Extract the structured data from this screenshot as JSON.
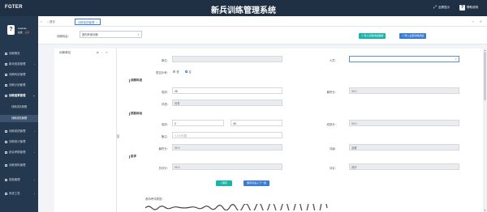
{
  "app": {
    "brand": "FGTER",
    "title": "新兵训练管理系统"
  },
  "top_actions": {
    "fullscreen_label": "全屏显示",
    "help_label": "帮助说明"
  },
  "user": {
    "avatar_text": "?",
    "name": "Auwbule",
    "status": "在线",
    "logout": "注销"
  },
  "sidebar": {
    "items": [
      {
        "label": "训练概览",
        "icon": "home-icon"
      },
      {
        "label": "新兵信息管理",
        "icon": "users-icon",
        "has_children": true
      },
      {
        "label": "训练科目管理",
        "icon": "list-icon"
      },
      {
        "label": "训练计划管理",
        "icon": "calendar-icon"
      },
      {
        "label": "训练结果管理",
        "icon": "edit-icon",
        "has_children": true,
        "open": true
      },
      {
        "label": "训练成绩管理",
        "icon": "chart-icon",
        "has_children": true
      },
      {
        "label": "训练统计管理",
        "icon": "stats-icon"
      },
      {
        "label": "综合考核管理",
        "icon": "check-icon",
        "has_children": true
      },
      {
        "label": "训练资料管理",
        "icon": "folder-icon"
      },
      {
        "label": "奖励管理",
        "icon": "award-icon",
        "has_children": true
      },
      {
        "label": "系统工具",
        "icon": "tool-icon",
        "has_children": true
      }
    ],
    "submenu": [
      {
        "label": "训练成绩管理",
        "active": false
      },
      {
        "label": "训练成绩管理",
        "active": true
      }
    ]
  },
  "tabs": {
    "home": "首页",
    "active": "训练成绩管理",
    "close": "×",
    "prev": "«",
    "next": "»",
    "refresh": "⟳"
  },
  "toolbar": {
    "subject_label": "训练科目：",
    "subject_value": "室内外体训练",
    "import_button": "导入训练成绩数据",
    "import_all_button": "导入全部训练成绩"
  },
  "tree": {
    "title": "训练单位",
    "icons": "⇄ ⌄ ⟳"
  },
  "form": {
    "unit_label": "单位：",
    "unit_value": "",
    "person_label": "人员：",
    "person_value": "",
    "makeup_label": "是否补考：",
    "radio_yes": "是",
    "radio_no": "否",
    "sections": {
      "sec1": "训练科目",
      "sec2": "技能综合",
      "sec3": "总评"
    },
    "score_label": "成绩：",
    "score1": "45",
    "final_label": "最终分：",
    "final1": "90.0",
    "rating_label": "评语：",
    "rating1": "优秀",
    "score2a": "0",
    "score2b": "45",
    "result_label": "成绩分：",
    "result2": "90.0",
    "remark_label": "备注：",
    "remark_placeholder": "0-100范围",
    "final2": "90.0",
    "level_label": "评级：",
    "level2": "及格",
    "total_label": "总评分：",
    "total3": "90.0",
    "grade_label": "评定：",
    "grade3": "良好"
  },
  "actions": {
    "save": "✓保存",
    "next": "保存并进入下一组"
  },
  "footer": {
    "note_label": "各科考评原因："
  },
  "colors": {
    "topbar": "#1f2f44",
    "sidebar": "#24384f",
    "accent": "#3a7bd5",
    "teal": "#1bb4a8"
  }
}
